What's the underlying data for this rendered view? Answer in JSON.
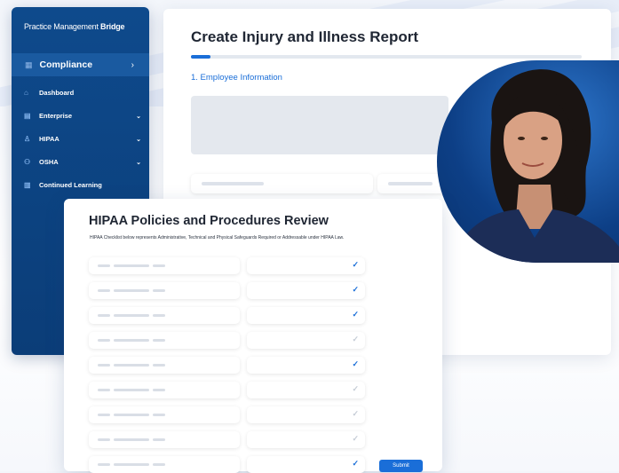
{
  "sidebar": {
    "brand_prefix": "Practice Management ",
    "brand_bold": "Bridge",
    "section": "Compliance",
    "items": [
      {
        "label": "Dashboard",
        "has_chevron": false
      },
      {
        "label": "Enterprise",
        "has_chevron": true
      },
      {
        "label": "HIPAA",
        "has_chevron": true
      },
      {
        "label": "OSHA",
        "has_chevron": true
      },
      {
        "label": "Continued Learning",
        "has_chevron": false
      }
    ]
  },
  "report": {
    "title": "Create Injury and Illness Report",
    "step": "1. Employee Information",
    "progress": 0.05
  },
  "hipaa": {
    "title": "HIPAA Policies and Procedures Review",
    "description": "HIPAA Checklist below represents Administrative, Technical and Physical Safeguards Required or Addressable under HIPAA Law.",
    "rows_checked": [
      true,
      true,
      true,
      false,
      true,
      false,
      false,
      false,
      true
    ],
    "submit_label": "Submit"
  },
  "colors": {
    "accent": "#1a6ed8",
    "sidebar": "#0e4a8c",
    "check_on": "#1a6ed8",
    "check_off": "#c5ccd6"
  }
}
